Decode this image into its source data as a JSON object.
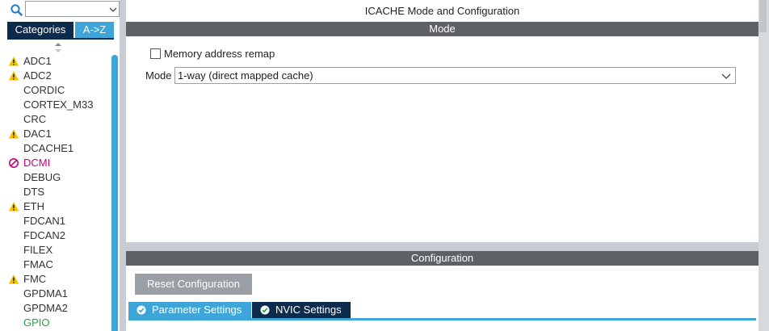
{
  "sidebar": {
    "search": {
      "value": "",
      "placeholder": ""
    },
    "tabs": {
      "categories": "Categories",
      "az": "A->Z"
    },
    "items": [
      {
        "label": "ADC1",
        "status": "warn",
        "color": "#333333"
      },
      {
        "label": "ADC2",
        "status": "warn",
        "color": "#333333"
      },
      {
        "label": "CORDIC",
        "status": "none",
        "color": "#333333"
      },
      {
        "label": "CORTEX_M33",
        "status": "none",
        "color": "#333333"
      },
      {
        "label": "CRC",
        "status": "none",
        "color": "#333333"
      },
      {
        "label": "DAC1",
        "status": "warn",
        "color": "#333333"
      },
      {
        "label": "DCACHE1",
        "status": "none",
        "color": "#333333"
      },
      {
        "label": "DCMI",
        "status": "disabled",
        "color": "#cc0077"
      },
      {
        "label": "DEBUG",
        "status": "none",
        "color": "#333333"
      },
      {
        "label": "DTS",
        "status": "none",
        "color": "#333333"
      },
      {
        "label": "ETH",
        "status": "warn",
        "color": "#333333"
      },
      {
        "label": "FDCAN1",
        "status": "none",
        "color": "#333333"
      },
      {
        "label": "FDCAN2",
        "status": "none",
        "color": "#333333"
      },
      {
        "label": "FILEX",
        "status": "none",
        "color": "#333333"
      },
      {
        "label": "FMAC",
        "status": "none",
        "color": "#333333"
      },
      {
        "label": "FMC",
        "status": "warn",
        "color": "#333333"
      },
      {
        "label": "GPDMA1",
        "status": "none",
        "color": "#333333"
      },
      {
        "label": "GPDMA2",
        "status": "none",
        "color": "#333333"
      },
      {
        "label": "GPIO",
        "status": "none",
        "color": "#2ea043"
      }
    ]
  },
  "panel": {
    "title": "ICACHE Mode and Configuration",
    "mode_section": "Mode",
    "memory_remap": {
      "label": "Memory address remap",
      "checked": false
    },
    "mode": {
      "label": "Mode",
      "value": "1-way (direct mapped cache)"
    }
  },
  "config": {
    "section": "Configuration",
    "reset_label": "Reset Configuration",
    "tabs": [
      {
        "label": "Parameter Settings",
        "active": true
      },
      {
        "label": "NVIC Settings",
        "active": false
      }
    ]
  },
  "colors": {
    "dark_navy": "#0d2b4c",
    "accent_blue": "#3ea5d8",
    "section_gray": "#5e6166",
    "warning_yellow": "#f5c400",
    "error_magenta": "#cc0077",
    "enabled_green": "#2ea043"
  }
}
